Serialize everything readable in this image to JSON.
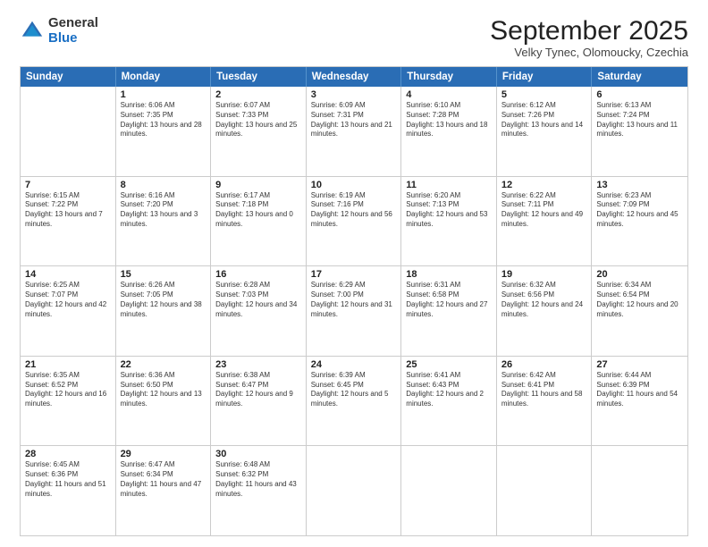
{
  "logo": {
    "general": "General",
    "blue": "Blue"
  },
  "header": {
    "month": "September 2025",
    "location": "Velky Tynec, Olomoucky, Czechia"
  },
  "days_of_week": [
    "Sunday",
    "Monday",
    "Tuesday",
    "Wednesday",
    "Thursday",
    "Friday",
    "Saturday"
  ],
  "weeks": [
    [
      {
        "day": "",
        "sunrise": "",
        "sunset": "",
        "daylight": ""
      },
      {
        "day": "1",
        "sunrise": "Sunrise: 6:06 AM",
        "sunset": "Sunset: 7:35 PM",
        "daylight": "Daylight: 13 hours and 28 minutes."
      },
      {
        "day": "2",
        "sunrise": "Sunrise: 6:07 AM",
        "sunset": "Sunset: 7:33 PM",
        "daylight": "Daylight: 13 hours and 25 minutes."
      },
      {
        "day": "3",
        "sunrise": "Sunrise: 6:09 AM",
        "sunset": "Sunset: 7:31 PM",
        "daylight": "Daylight: 13 hours and 21 minutes."
      },
      {
        "day": "4",
        "sunrise": "Sunrise: 6:10 AM",
        "sunset": "Sunset: 7:28 PM",
        "daylight": "Daylight: 13 hours and 18 minutes."
      },
      {
        "day": "5",
        "sunrise": "Sunrise: 6:12 AM",
        "sunset": "Sunset: 7:26 PM",
        "daylight": "Daylight: 13 hours and 14 minutes."
      },
      {
        "day": "6",
        "sunrise": "Sunrise: 6:13 AM",
        "sunset": "Sunset: 7:24 PM",
        "daylight": "Daylight: 13 hours and 11 minutes."
      }
    ],
    [
      {
        "day": "7",
        "sunrise": "Sunrise: 6:15 AM",
        "sunset": "Sunset: 7:22 PM",
        "daylight": "Daylight: 13 hours and 7 minutes."
      },
      {
        "day": "8",
        "sunrise": "Sunrise: 6:16 AM",
        "sunset": "Sunset: 7:20 PM",
        "daylight": "Daylight: 13 hours and 3 minutes."
      },
      {
        "day": "9",
        "sunrise": "Sunrise: 6:17 AM",
        "sunset": "Sunset: 7:18 PM",
        "daylight": "Daylight: 13 hours and 0 minutes."
      },
      {
        "day": "10",
        "sunrise": "Sunrise: 6:19 AM",
        "sunset": "Sunset: 7:16 PM",
        "daylight": "Daylight: 12 hours and 56 minutes."
      },
      {
        "day": "11",
        "sunrise": "Sunrise: 6:20 AM",
        "sunset": "Sunset: 7:13 PM",
        "daylight": "Daylight: 12 hours and 53 minutes."
      },
      {
        "day": "12",
        "sunrise": "Sunrise: 6:22 AM",
        "sunset": "Sunset: 7:11 PM",
        "daylight": "Daylight: 12 hours and 49 minutes."
      },
      {
        "day": "13",
        "sunrise": "Sunrise: 6:23 AM",
        "sunset": "Sunset: 7:09 PM",
        "daylight": "Daylight: 12 hours and 45 minutes."
      }
    ],
    [
      {
        "day": "14",
        "sunrise": "Sunrise: 6:25 AM",
        "sunset": "Sunset: 7:07 PM",
        "daylight": "Daylight: 12 hours and 42 minutes."
      },
      {
        "day": "15",
        "sunrise": "Sunrise: 6:26 AM",
        "sunset": "Sunset: 7:05 PM",
        "daylight": "Daylight: 12 hours and 38 minutes."
      },
      {
        "day": "16",
        "sunrise": "Sunrise: 6:28 AM",
        "sunset": "Sunset: 7:03 PM",
        "daylight": "Daylight: 12 hours and 34 minutes."
      },
      {
        "day": "17",
        "sunrise": "Sunrise: 6:29 AM",
        "sunset": "Sunset: 7:00 PM",
        "daylight": "Daylight: 12 hours and 31 minutes."
      },
      {
        "day": "18",
        "sunrise": "Sunrise: 6:31 AM",
        "sunset": "Sunset: 6:58 PM",
        "daylight": "Daylight: 12 hours and 27 minutes."
      },
      {
        "day": "19",
        "sunrise": "Sunrise: 6:32 AM",
        "sunset": "Sunset: 6:56 PM",
        "daylight": "Daylight: 12 hours and 24 minutes."
      },
      {
        "day": "20",
        "sunrise": "Sunrise: 6:34 AM",
        "sunset": "Sunset: 6:54 PM",
        "daylight": "Daylight: 12 hours and 20 minutes."
      }
    ],
    [
      {
        "day": "21",
        "sunrise": "Sunrise: 6:35 AM",
        "sunset": "Sunset: 6:52 PM",
        "daylight": "Daylight: 12 hours and 16 minutes."
      },
      {
        "day": "22",
        "sunrise": "Sunrise: 6:36 AM",
        "sunset": "Sunset: 6:50 PM",
        "daylight": "Daylight: 12 hours and 13 minutes."
      },
      {
        "day": "23",
        "sunrise": "Sunrise: 6:38 AM",
        "sunset": "Sunset: 6:47 PM",
        "daylight": "Daylight: 12 hours and 9 minutes."
      },
      {
        "day": "24",
        "sunrise": "Sunrise: 6:39 AM",
        "sunset": "Sunset: 6:45 PM",
        "daylight": "Daylight: 12 hours and 5 minutes."
      },
      {
        "day": "25",
        "sunrise": "Sunrise: 6:41 AM",
        "sunset": "Sunset: 6:43 PM",
        "daylight": "Daylight: 12 hours and 2 minutes."
      },
      {
        "day": "26",
        "sunrise": "Sunrise: 6:42 AM",
        "sunset": "Sunset: 6:41 PM",
        "daylight": "Daylight: 11 hours and 58 minutes."
      },
      {
        "day": "27",
        "sunrise": "Sunrise: 6:44 AM",
        "sunset": "Sunset: 6:39 PM",
        "daylight": "Daylight: 11 hours and 54 minutes."
      }
    ],
    [
      {
        "day": "28",
        "sunrise": "Sunrise: 6:45 AM",
        "sunset": "Sunset: 6:36 PM",
        "daylight": "Daylight: 11 hours and 51 minutes."
      },
      {
        "day": "29",
        "sunrise": "Sunrise: 6:47 AM",
        "sunset": "Sunset: 6:34 PM",
        "daylight": "Daylight: 11 hours and 47 minutes."
      },
      {
        "day": "30",
        "sunrise": "Sunrise: 6:48 AM",
        "sunset": "Sunset: 6:32 PM",
        "daylight": "Daylight: 11 hours and 43 minutes."
      },
      {
        "day": "",
        "sunrise": "",
        "sunset": "",
        "daylight": ""
      },
      {
        "day": "",
        "sunrise": "",
        "sunset": "",
        "daylight": ""
      },
      {
        "day": "",
        "sunrise": "",
        "sunset": "",
        "daylight": ""
      },
      {
        "day": "",
        "sunrise": "",
        "sunset": "",
        "daylight": ""
      }
    ]
  ]
}
